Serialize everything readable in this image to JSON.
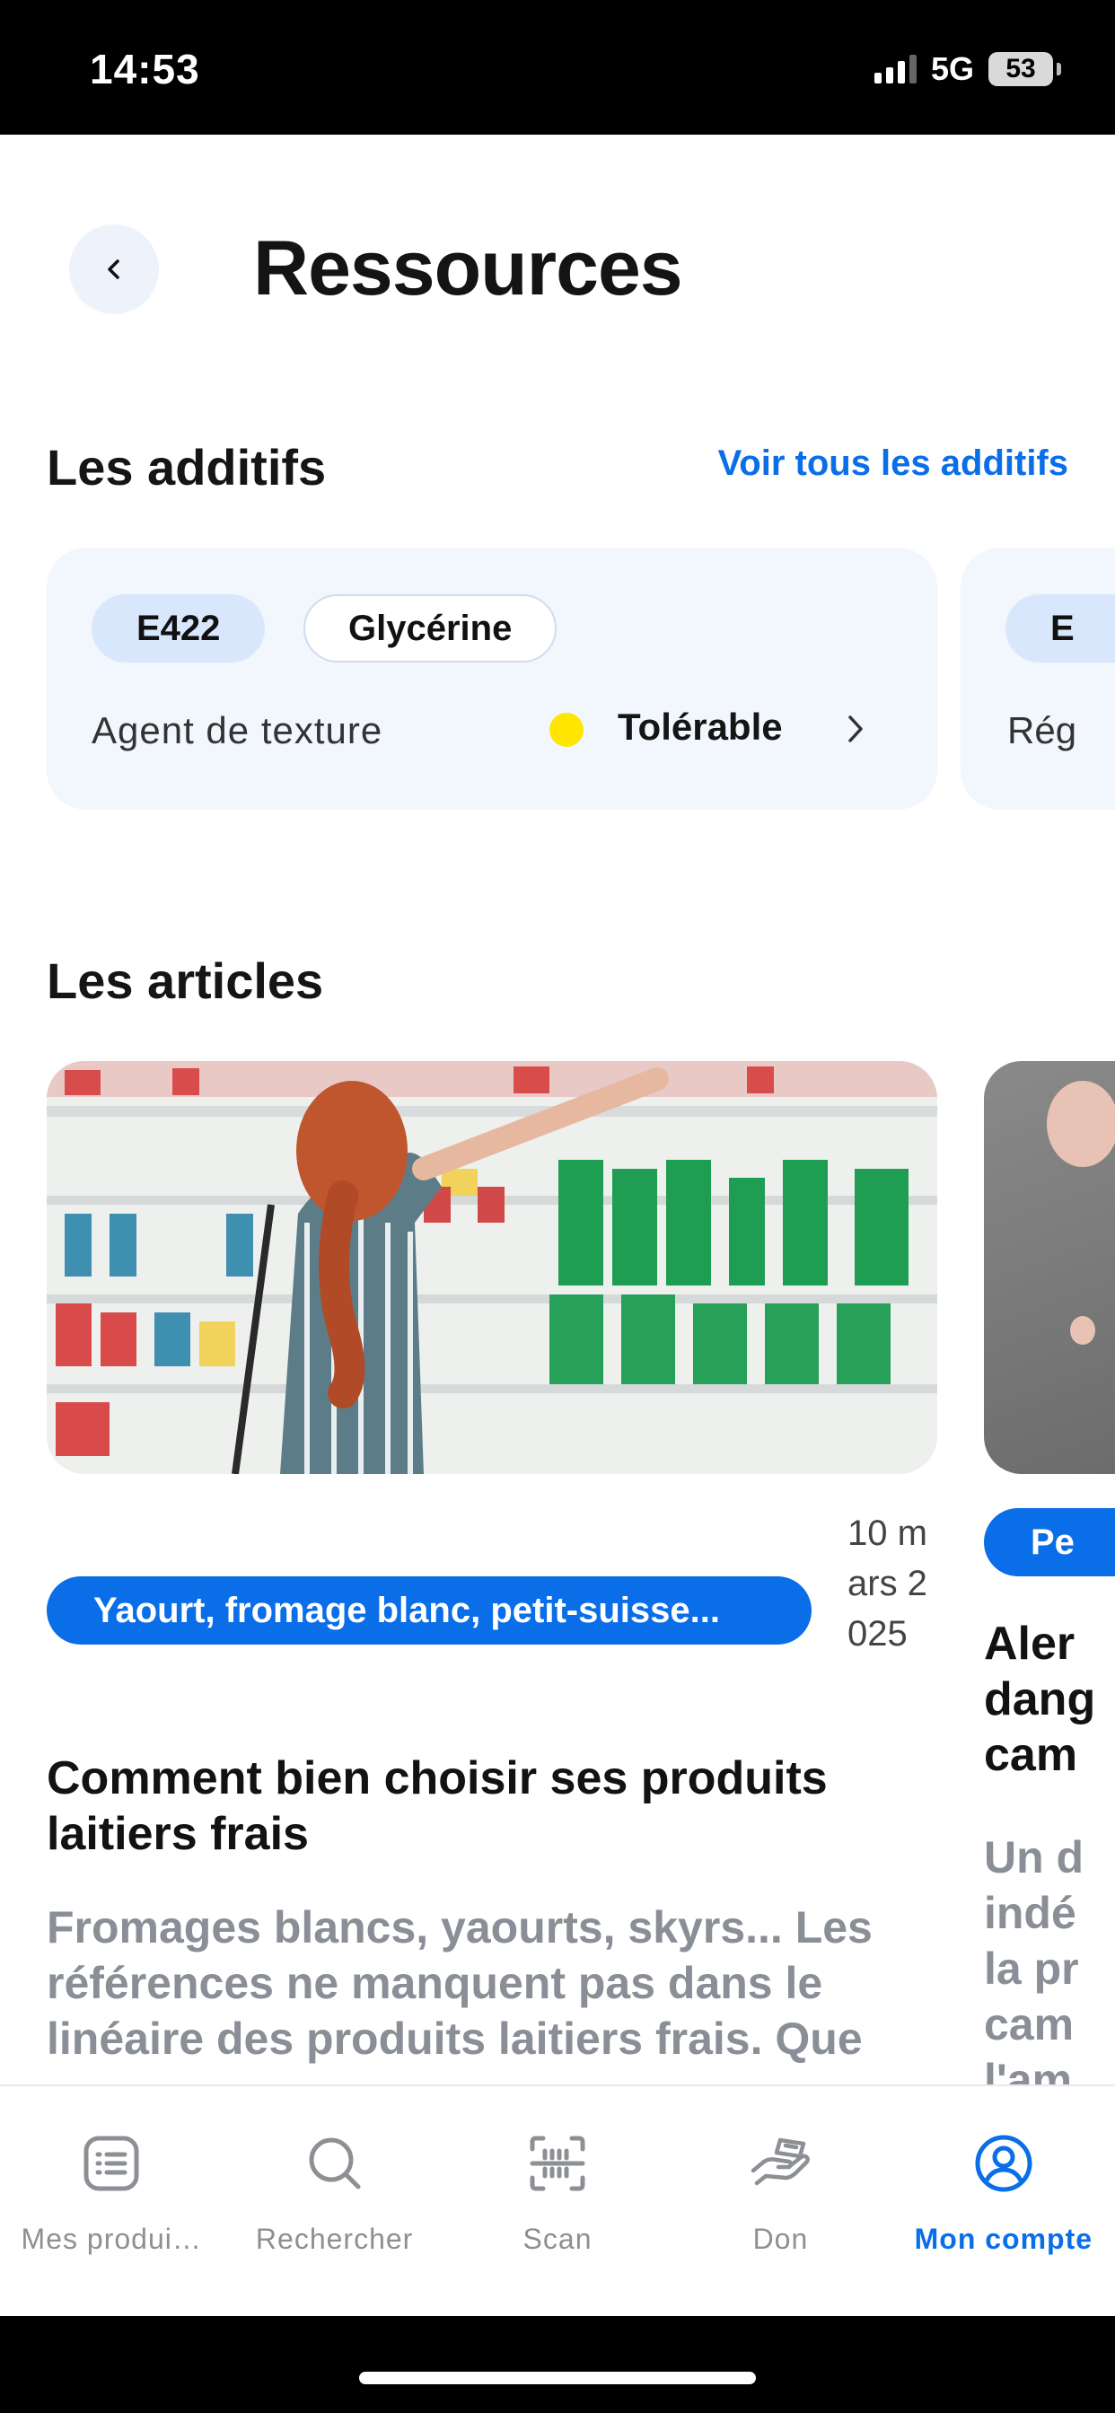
{
  "status_bar": {
    "time": "14:53",
    "network": "5G",
    "battery": "53"
  },
  "header": {
    "title": "Ressources"
  },
  "additives": {
    "section_title": "Les additifs",
    "see_all_label": "Voir tous les additifs",
    "items": [
      {
        "code": "E422",
        "name": "Glycérine",
        "category": "Agent de texture",
        "status": "Tolérable",
        "status_color": "#ffe600"
      },
      {
        "code": "E",
        "category": "Rég"
      }
    ]
  },
  "articles": {
    "section_title": "Les articles",
    "items": [
      {
        "tag": "Yaourt, fromage blanc, petit-suisse...",
        "date": "10 mars 2025",
        "title": "Comment bien choisir ses produits laitiers frais",
        "excerpt": "Fromages blancs, yaourts, skyrs... Les références ne manquent pas dans le linéaire des produits laitiers frais. Que"
      },
      {
        "tag": "Pe",
        "title": "Aler\ndang\ncam",
        "excerpt": "Un d\nindé\nla pr\ncam\nl'am"
      }
    ]
  },
  "tab_bar": {
    "active_color": "#0a6ee8",
    "tabs": [
      {
        "label": "Mes produi…",
        "icon": "list-icon"
      },
      {
        "label": "Rechercher",
        "icon": "search-icon"
      },
      {
        "label": "Scan",
        "icon": "barcode-scan-icon"
      },
      {
        "label": "Don",
        "icon": "donate-hand-icon"
      },
      {
        "label": "Mon compte",
        "icon": "account-icon",
        "active": true
      }
    ]
  }
}
